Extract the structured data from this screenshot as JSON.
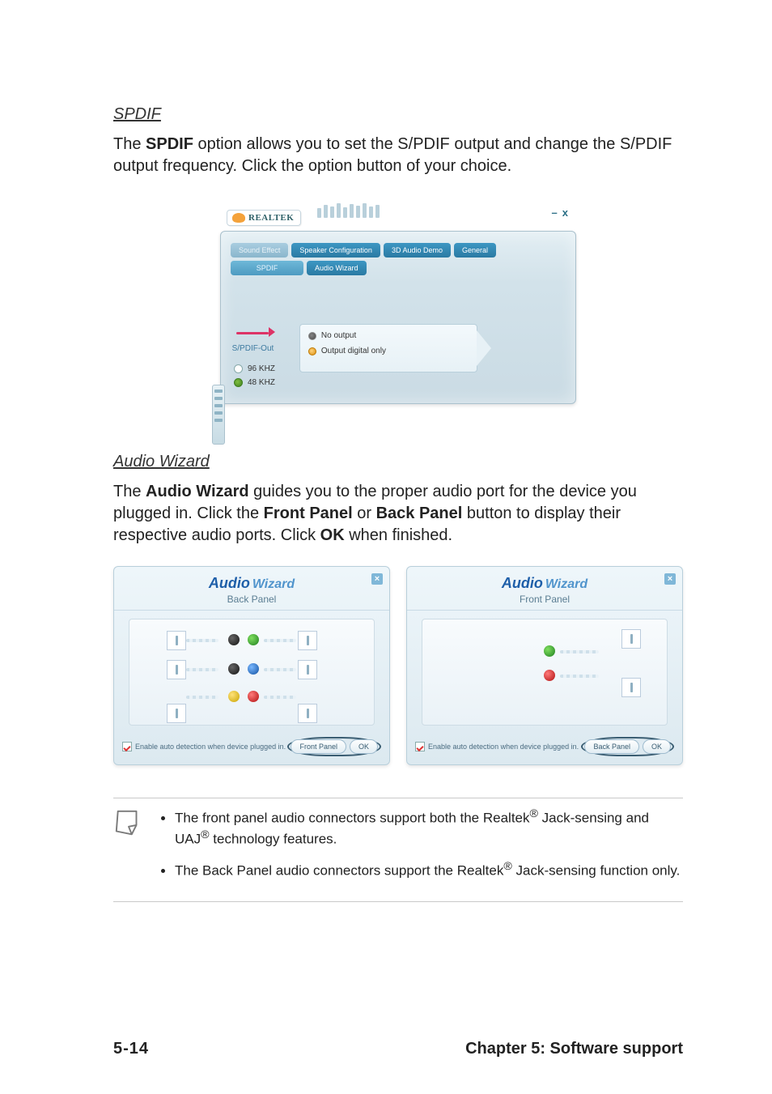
{
  "section1": {
    "heading": "SPDIF",
    "para_pre": "The ",
    "para_bold": "SPDIF",
    "para_post": " option allows you to set the S/PDIF output and change the S/PDIF output frequency. Click the option button of your choice."
  },
  "realtek": {
    "brand": "REALTEK",
    "win_min": "–",
    "win_close": "x",
    "tabs_row1": [
      "Sound Effect",
      "Speaker Configuration",
      "3D Audio Demo",
      "General"
    ],
    "tabs_row2": [
      "SPDIF",
      "Audio Wizard"
    ],
    "spdif_label": "S/PDIF-Out",
    "freq1": "96 KHZ",
    "freq2": "48 KHZ",
    "opt1": "No output",
    "opt2": "Output digital only"
  },
  "section2": {
    "heading": "Audio Wizard",
    "p_pre": "The ",
    "p_b1": "Audio Wizard",
    "p_mid1": " guides you to the proper audio port for the device you plugged in. Click the ",
    "p_b2": "Front Panel",
    "p_mid2": " or ",
    "p_b3": "Back Panel",
    "p_mid3": " button to display their respective audio ports. Click ",
    "p_b4": "OK",
    "p_post": " when finished."
  },
  "wizard": {
    "title_a": "Audio",
    "title_b": "Wizard",
    "left_subtitle": "Back Panel",
    "right_subtitle": "Front Panel",
    "checkbox_label": "Enable auto detection when device plugged in.",
    "btn_front": "Front Panel",
    "btn_back": "Back Panel",
    "btn_ok": "OK",
    "close": "×"
  },
  "notes": {
    "li1_pre": "The front panel audio connectors support both the Realtek",
    "li1_post": " Jack-sensing and UAJ",
    "li1_tail": " technology features.",
    "li2_pre": "The Back Panel audio connectors support the Realtek",
    "li2_post": " Jack-sensing function only.",
    "reg": "®"
  },
  "footer": {
    "page": "5-14",
    "chapter": "Chapter 5: Software support"
  }
}
